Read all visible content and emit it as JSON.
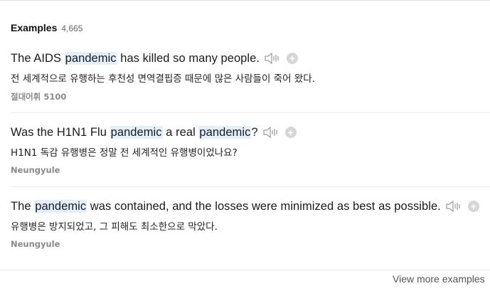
{
  "header": {
    "title": "Examples",
    "count": "4,665"
  },
  "examples": [
    {
      "parts": [
        "The AIDS ",
        "pandemic",
        " has killed so many people."
      ],
      "translation": "전 세계적으로 유행하는 후천성 면역결핍증 때문에 많은 사람들이 죽어 왔다.",
      "source": "절대어휘 5100"
    },
    {
      "parts": [
        "Was the H1N1 Flu ",
        "pandemic",
        " a real ",
        "pandemic",
        "?"
      ],
      "translation": "H1N1 독감 유행병은 정말 전 세계적인 유행병이었나요?",
      "source": "Neungyule"
    },
    {
      "parts": [
        "The ",
        "pandemic",
        " was contained, and the losses were minimized as best as possible."
      ],
      "translation": "유행병은 방지되었고, 그 피해도 최소한으로 막았다.",
      "source": "Neungyule"
    }
  ],
  "icons": {
    "speaker": "speaker-icon",
    "add": "plus-circle-icon"
  },
  "footer": {
    "view_more_label": "View more examples"
  },
  "colors": {
    "highlight": "#e4effd",
    "add_button": "#d6d6d6",
    "source_text": "#8a8a8a"
  }
}
